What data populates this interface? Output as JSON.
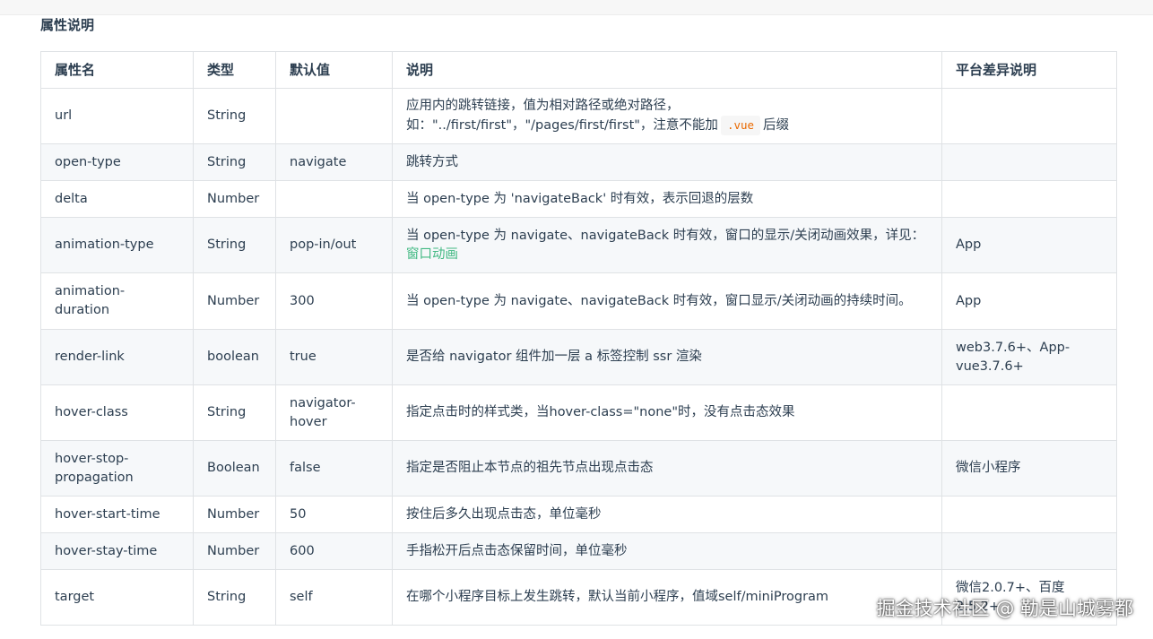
{
  "section_title": "属性说明",
  "table": {
    "headers": [
      "属性名",
      "类型",
      "默认值",
      "说明",
      "平台差异说明"
    ],
    "rows": [
      {
        "name": "url",
        "type": "String",
        "default": "",
        "desc_line1": "应用内的跳转链接，值为相对路径或绝对路径，",
        "desc_line2_pre": "如：\"../first/first\"，\"/pages/first/first\"，注意不能加",
        "desc_code": ".vue",
        "desc_line2_post": "后缀",
        "platform": ""
      },
      {
        "name": "open-type",
        "type": "String",
        "default": "navigate",
        "desc": "跳转方式",
        "platform": ""
      },
      {
        "name": "delta",
        "type": "Number",
        "default": "",
        "desc": "当 open-type 为 'navigateBack' 时有效，表示回退的层数",
        "platform": ""
      },
      {
        "name": "animation-type",
        "type": "String",
        "default": "pop-in/out",
        "desc_pre": "当 open-type 为 navigate、navigateBack 时有效，窗口的显示/关闭动画效果，详见：",
        "desc_link": "窗口动画",
        "platform": "App"
      },
      {
        "name": "animation-duration",
        "type": "Number",
        "default": "300",
        "desc": "当 open-type 为 navigate、navigateBack 时有效，窗口显示/关闭动画的持续时间。",
        "platform": "App"
      },
      {
        "name": "render-link",
        "type": "boolean",
        "default": "true",
        "desc": "是否给 navigator 组件加一层 a 标签控制 ssr 渲染",
        "platform": "web3.7.6+、App-vue3.7.6+"
      },
      {
        "name": "hover-class",
        "type": "String",
        "default": "navigator-hover",
        "desc": "指定点击时的样式类，当hover-class=\"none\"时，没有点击态效果",
        "platform": ""
      },
      {
        "name": "hover-stop-propagation",
        "type": "Boolean",
        "default": "false",
        "desc": "指定是否阻止本节点的祖先节点出现点击态",
        "platform": "微信小程序"
      },
      {
        "name": "hover-start-time",
        "type": "Number",
        "default": "50",
        "desc": "按住后多久出现点击态，单位毫秒",
        "platform": ""
      },
      {
        "name": "hover-stay-time",
        "type": "Number",
        "default": "600",
        "desc": "手指松开后点击态保留时间，单位毫秒",
        "platform": ""
      },
      {
        "name": "target",
        "type": "String",
        "default": "self",
        "desc": "在哪个小程序目标上发生跳转，默认当前小程序，值域self/miniProgram",
        "platform": "微信2.0.7+、百度2.5.2+"
      }
    ]
  },
  "watermark": "掘金技术社区 @ 勒是山城雾都"
}
